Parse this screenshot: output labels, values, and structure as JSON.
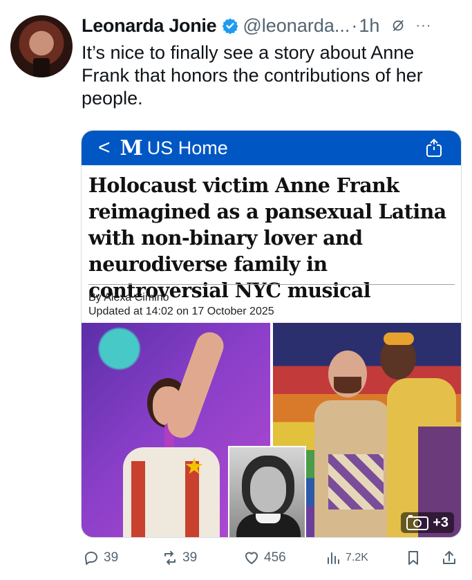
{
  "tweet": {
    "author_name": "Leonarda Jonie",
    "handle": "@leonarda...",
    "separator": "·",
    "time": "1h",
    "more": "···",
    "text": "It’s nice to finally see a story about Anne Frank that honors the contributions of her people."
  },
  "card": {
    "back": "<",
    "logo": "M",
    "section": "US Home",
    "headline": "Holocaust victim Anne Frank reimagined as a pansexual Latina with non-binary lover and neurodiverse family in controversial NYC musical",
    "byline": "By Alexa Cimino",
    "updated": "Updated at 14:02 on 17 October 2025",
    "gallery_count": "+3"
  },
  "actions": {
    "replies": "39",
    "reposts": "39",
    "likes": "456",
    "views": "7.2K"
  },
  "colors": {
    "brand_bar": "#0057c3",
    "verified": "#1d9bf0",
    "muted_text": "#536471"
  }
}
